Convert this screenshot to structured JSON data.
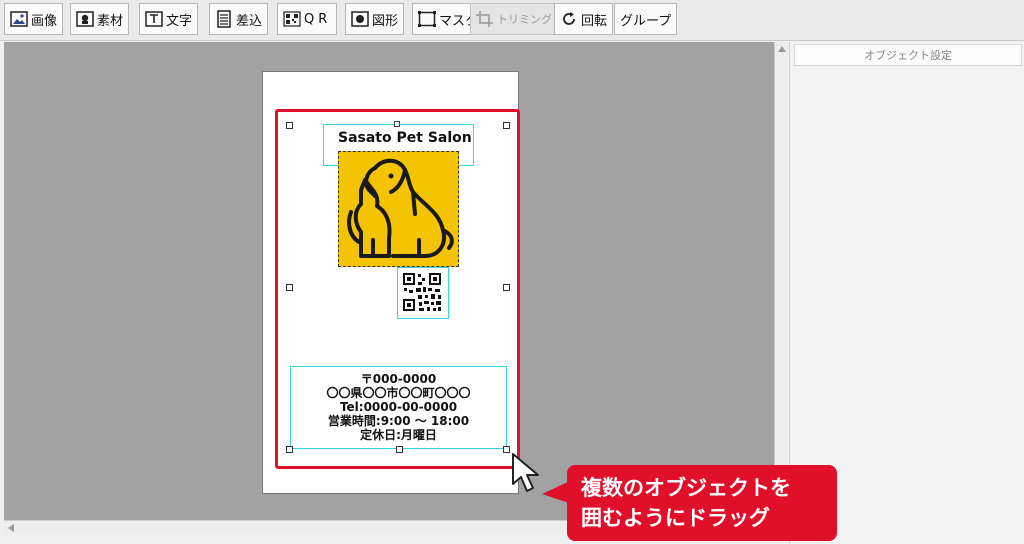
{
  "toolbar": {
    "buttons": [
      {
        "label": "画像",
        "icon": "image-icon"
      },
      {
        "label": "素材",
        "icon": "material-icon"
      },
      {
        "label": "文字",
        "icon": "text-icon"
      },
      {
        "label": "差込",
        "icon": "merge-icon"
      },
      {
        "label": "QR",
        "icon": "qr-icon"
      },
      {
        "label": "図形",
        "icon": "shape-icon"
      },
      {
        "label": "マスク",
        "icon": "mask-icon"
      },
      {
        "label": "トリミング",
        "icon": "crop-icon",
        "disabled": true
      },
      {
        "label": "回転",
        "icon": "rotate-icon"
      },
      {
        "label": "グループ",
        "icon": ""
      }
    ]
  },
  "panel": {
    "title": "オブジェクト設定"
  },
  "card": {
    "title": "Sasato Pet Salon",
    "address_lines": [
      "〒000-0000",
      "〇〇県〇〇市〇〇町〇〇〇",
      "Tel:0000-00-0000",
      "営業時間:9:00 ～ 18:00",
      "定休日:月曜日"
    ],
    "logo_color": "#f5c400"
  },
  "callout": {
    "line1": "複数のオブジェクトを",
    "line2": "囲むようにドラッグ",
    "color": "#e0102a"
  }
}
